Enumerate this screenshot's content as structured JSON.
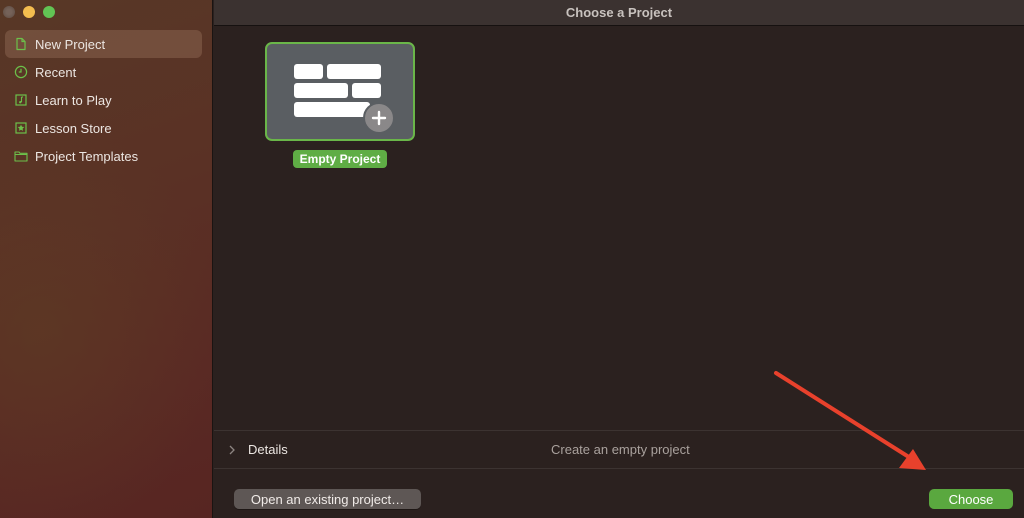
{
  "window": {
    "title": "Choose a Project",
    "traffic_lights": [
      "close",
      "minimize",
      "maximize"
    ]
  },
  "sidebar": {
    "items": [
      {
        "label": "New Project",
        "icon": "document-icon",
        "active": true
      },
      {
        "label": "Recent",
        "icon": "clock-icon",
        "active": false
      },
      {
        "label": "Learn to Play",
        "icon": "music-note-icon",
        "active": false
      },
      {
        "label": "Lesson Store",
        "icon": "star-box-icon",
        "active": false
      },
      {
        "label": "Project Templates",
        "icon": "folder-icon",
        "active": false
      }
    ]
  },
  "main": {
    "templates": [
      {
        "label": "Empty Project",
        "icon": "empty-project-icon",
        "selected": true
      }
    ],
    "details": {
      "label": "Details",
      "description": "Create an empty project"
    },
    "buttons": {
      "open_existing": "Open an existing project…",
      "choose": "Choose"
    }
  },
  "colors": {
    "accent_green": "#5fad45",
    "annotation_arrow": "#e8412c"
  },
  "annotation": {
    "type": "arrow",
    "points_to": "choose-button"
  }
}
